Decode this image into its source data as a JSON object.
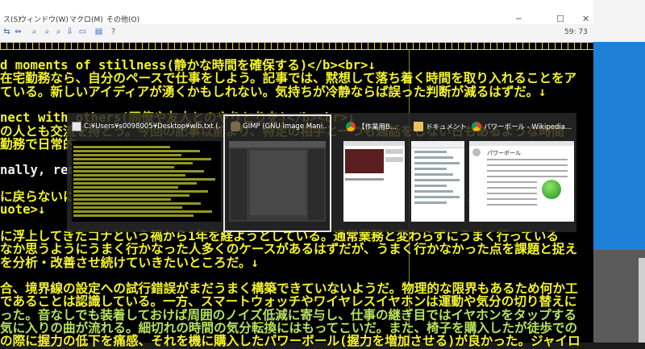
{
  "editor": {
    "menu": [
      "ス(S)",
      "ウィンドウ(W)",
      "マクロ(M)",
      "その他(O)"
    ],
    "cursor_position": "59: 73",
    "lines": [
      {
        "text": "d moments of stillness(静かな時間を確保する)</b><br>↓",
        "style": "y"
      },
      {
        "text": "在宅勤務なら、自分のペースで仕事をしよう。記事では、黙想して落ち着く時間を取り入れることをア",
        "style": "y"
      },
      {
        "text": "ている。新しいアイディアが湧くかもしれない。気持ちが冷静ならば誤った判断が減るはずだ。↓",
        "style": "y"
      },
      {
        "text": "",
        "style": "y"
      },
      {
        "text": "nect with others(同僚や友人とのやりとりを)</b><br>↓",
        "style": "y"
      },
      {
        "text": "の人とも交流を持とう。今回の記事以前より、特定の相手と一つも通話をしない日もあるような時間",
        "style": "y"
      },
      {
        "text": "勤務で日常的",
        "style": "y"
      },
      {
        "text": "",
        "style": "y"
      },
      {
        "text": "nally, remind                                              as  over                    b><",
        "style": "w"
      },
      {
        "text": "",
        "style": "y"
      },
      {
        "text": "に戻らないに                                                  をンジデー ことを",
        "style": "y"
      },
      {
        "text": "uote>↓",
        "style": "y"
      },
      {
        "text": "",
        "style": "y"
      },
      {
        "text": "に浮上してきたコナという禍から1年を経ようとしている。通常業務と変わらずにうまく行っている",
        "style": "y"
      },
      {
        "text": "なか思うようにうまく行かなった人多くのケースがあるはずだが、うまく行かなかった点を課題と捉え",
        "style": "y"
      },
      {
        "text": "を分析・改善させ続けていきたいところだ。↓",
        "style": "y"
      },
      {
        "text": "",
        "style": "y"
      },
      {
        "text": "合、境界線の設定への試行錯誤がまだうまく構築できていないようだ。物理的な限界もあるため何か工",
        "style": "y"
      },
      {
        "text": "であることは認識している。一方、スマートウォッチやワイヤレスイヤホンは運動や気分の切り替えに",
        "style": "y"
      },
      {
        "text": "った。音なしでも装着しておけば周囲のノイズ低減に寄与し、仕事の継ぎ目ではイヤホンをタップする",
        "style": "g"
      },
      {
        "text": "気に入りの曲が流れる。細切れの時間の気分転換にはもってこいだ。また、椅子を購入したが徒歩での",
        "style": "g"
      },
      {
        "text": "の際に握力の低下を痛感、それを機に購入したパワーボール(握力を増加させる)が良かった。ジャイロ",
        "style": "y"
      }
    ]
  },
  "switcher": {
    "windows": [
      {
        "title": "C:¥Users¥s0098005¥Desktop¥wlb.txt (...",
        "app": "text-editor",
        "icon": "editor-app-icon"
      },
      {
        "title": "GIMP (GNU Image Mani...",
        "app": "gimp",
        "icon": "gimp-app-icon",
        "selected": true
      },
      {
        "title": "【作業用B...",
        "app": "chrome",
        "icon": "chrome-icon"
      },
      {
        "title": "ドキュメント",
        "app": "explorer",
        "icon": "folder-icon"
      },
      {
        "title": "パワーボール - Wikipedia...",
        "app": "chrome",
        "icon": "chrome-icon"
      }
    ],
    "previews": {
      "wiki_heading": "パワーボール"
    }
  },
  "colors": {
    "text_yellow": "#f3f32a",
    "text_green": "#b6e25a",
    "switcher_bg": "#282828",
    "desktop_blue": "#1e7fd6"
  }
}
